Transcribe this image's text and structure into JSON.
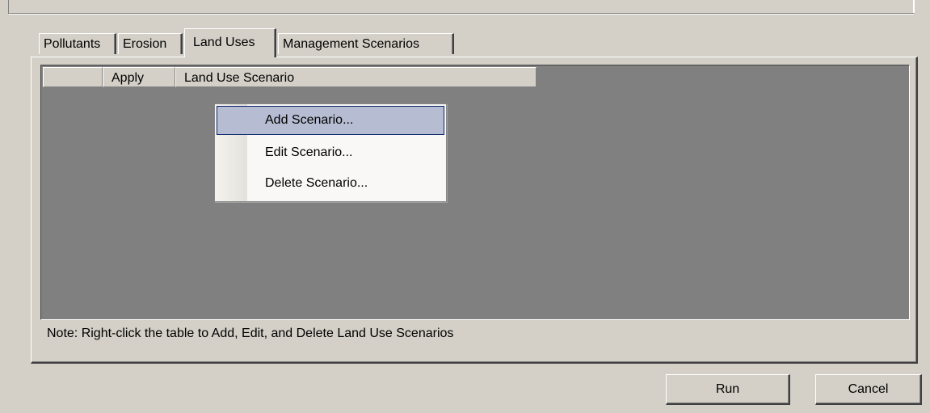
{
  "tabs": [
    {
      "label": "Pollutants",
      "active": false
    },
    {
      "label": "Erosion",
      "active": false
    },
    {
      "label": "Land Uses",
      "active": true
    },
    {
      "label": "Management Scenarios",
      "active": false
    }
  ],
  "grid": {
    "columns": [
      "",
      "Apply",
      "Land Use Scenario"
    ]
  },
  "context_menu": {
    "items": [
      "Add Scenario...",
      "Edit Scenario...",
      "Delete Scenario..."
    ],
    "highlighted": "Add Scenario..."
  },
  "note": "Note: Right-click the table to Add, Edit, and Delete Land Use Scenarios",
  "buttons": {
    "run": "Run",
    "cancel": "Cancel"
  },
  "colors": {
    "dialog_bg": "#d4d0c8",
    "grid_bg": "#808080",
    "menu_highlight": "#b6bdd2",
    "menu_highlight_border": "#0a246a"
  }
}
